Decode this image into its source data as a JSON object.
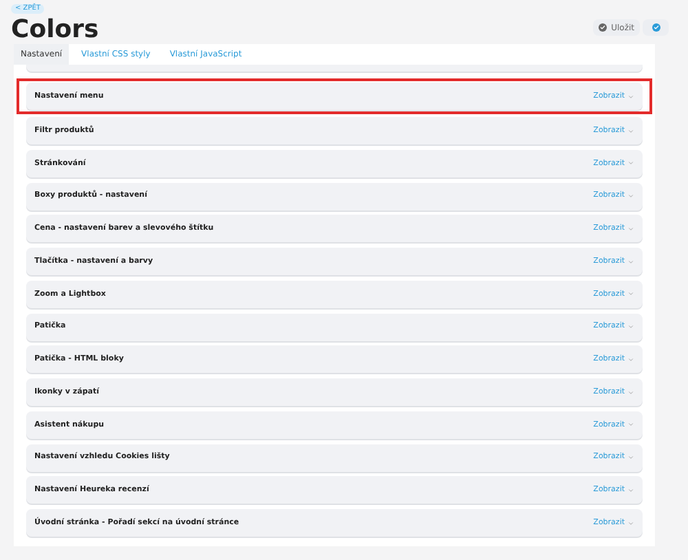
{
  "back_link": "< ZPĚT",
  "title": "Colors",
  "save_button": "Uložit",
  "tabs": [
    {
      "label": "Nastavení",
      "selected": true
    },
    {
      "label": "Vlastní CSS styly",
      "selected": false
    },
    {
      "label": "Vlastní JavaScript",
      "selected": false
    }
  ],
  "sections": [
    {
      "label": "Nastavení menu",
      "action": "Zobrazit",
      "highlighted": true
    },
    {
      "label": "Filtr produktů",
      "action": "Zobrazit",
      "highlighted": false
    },
    {
      "label": "Stránkování",
      "action": "Zobrazit",
      "highlighted": false
    },
    {
      "label": "Boxy produktů - nastavení",
      "action": "Zobrazit",
      "highlighted": false
    },
    {
      "label": "Cena - nastavení barev a slevového štítku",
      "action": "Zobrazit",
      "highlighted": false
    },
    {
      "label": "Tlačítka - nastavení a barvy",
      "action": "Zobrazit",
      "highlighted": false
    },
    {
      "label": "Zoom a Lightbox",
      "action": "Zobrazit",
      "highlighted": false
    },
    {
      "label": "Patička",
      "action": "Zobrazit",
      "highlighted": false
    },
    {
      "label": "Patička - HTML bloky",
      "action": "Zobrazit",
      "highlighted": false
    },
    {
      "label": "Ikonky v zápatí",
      "action": "Zobrazit",
      "highlighted": false
    },
    {
      "label": "Asistent nákupu",
      "action": "Zobrazit",
      "highlighted": false
    },
    {
      "label": "Nastavení vzhledu Cookies lišty",
      "action": "Zobrazit",
      "highlighted": false
    },
    {
      "label": "Nastavení Heureka recenzí",
      "action": "Zobrazit",
      "highlighted": false
    },
    {
      "label": "Úvodní stránka - Pořadí sekcí na úvodní stránce",
      "action": "Zobrazit",
      "highlighted": false
    }
  ]
}
